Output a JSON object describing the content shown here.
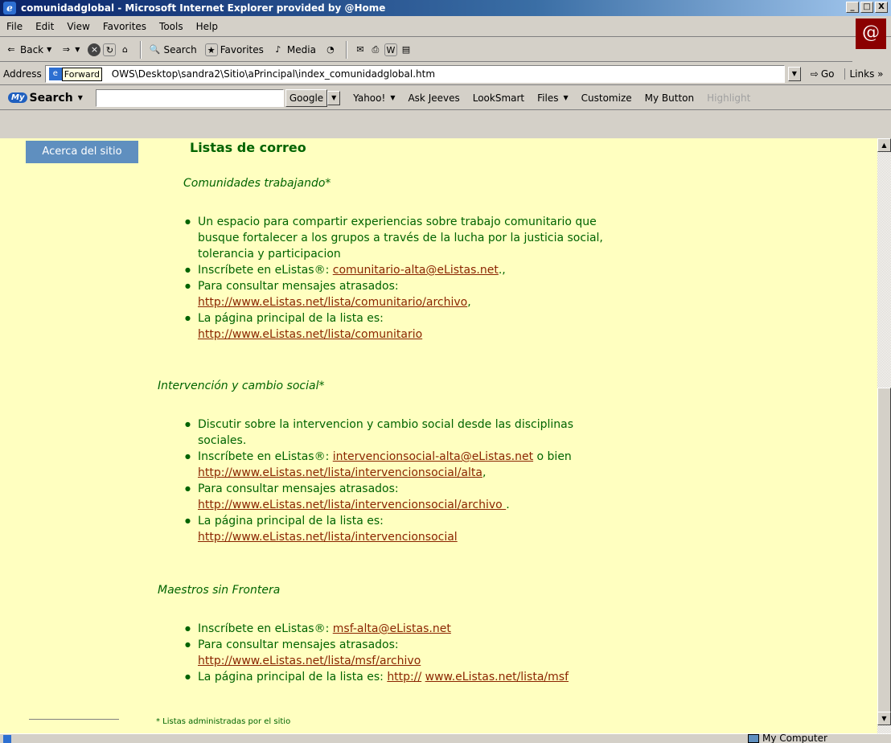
{
  "window": {
    "title": "comunidadglobal - Microsoft Internet Explorer provided by @Home",
    "controls": [
      "_",
      "□",
      "X"
    ]
  },
  "menu": [
    "File",
    "Edit",
    "View",
    "Favorites",
    "Tools",
    "Help"
  ],
  "toolbar": {
    "back": "Back",
    "search": "Search",
    "favorites": "Favorites",
    "media": "Media"
  },
  "address": {
    "label": "Address",
    "url": "OWS\\Desktop\\sandra2\\Sitio\\aPrincipal\\index_comunidadglobal.htm",
    "tooltip": "Forward",
    "go": "Go",
    "links": "Links »"
  },
  "searchbar": {
    "brand_badge": "My",
    "brand": "Search",
    "google": "Google",
    "items": [
      "Yahoo!",
      "Ask Jeeves",
      "LookSmart",
      "Files",
      "Customize",
      "My Button",
      "Highlight"
    ]
  },
  "sidebar": {
    "button": "Acerca del sitio"
  },
  "content": {
    "heading": "Listas de correo",
    "sections": [
      {
        "title": "Comunidades trabajando*",
        "items": [
          {
            "text": "Un espacio para compartir experiencias sobre trabajo comunitario que busque fortalecer a los grupos a través de la lucha por la justicia social, tolerancia y participacion"
          },
          {
            "text": "Inscríbete en eListas®: ",
            "link": "comunitario-alta@eListas.net",
            "after": "., "
          },
          {
            "text": "Para consultar mensajes atrasados: ",
            "link": "http://www.eListas.net/lista/comunitario/archivo",
            "after": ","
          },
          {
            "text": "La página principal de la lista es:",
            "link": "http://www.eListas.net/lista/comunitario",
            "after": ""
          }
        ]
      },
      {
        "title": "Intervención y cambio social*",
        "items": [
          {
            "text": "Discutir sobre la intervencion y cambio social desde las disciplinas sociales."
          },
          {
            "text": "Inscríbete en eListas®: ",
            "link": "intervencionsocial-alta@eListas.net",
            "after": " o bien ",
            "link2": "http://www.eListas.net/lista/intervencionsocial/alta",
            "after2": ","
          },
          {
            "text": "Para consultar mensajes atrasados: ",
            "link": "http://www.eListas.net/lista/intervencionsocial/archivo ",
            "after": "."
          },
          {
            "text": "La página principal de la lista es: ",
            "link": "http://www.eListas.net/lista/intervencionsocial",
            "after": ""
          }
        ]
      },
      {
        "title": "Maestros sin Frontera",
        "items": [
          {
            "text": "Inscríbete en eListas®: ",
            "link": "msf-alta@eListas.net",
            "after": ""
          },
          {
            "text": "Para consultar mensajes atrasados: ",
            "link": "http://www.eListas.net/lista/msf/archivo",
            "after": ""
          },
          {
            "text": "La página principal de la lista es: ",
            "link": "http://",
            "after": " ",
            "link2": "www.eListas.net/lista/msf",
            "after2": ""
          }
        ]
      }
    ],
    "footnote": "* Listas administradas por el sitio"
  },
  "status": {
    "zone": "My Computer"
  },
  "colors": {
    "page_bg": "#ffffc0",
    "text_green": "#006400",
    "link": "#8b2500",
    "sidebar_btn": "#5f8fbf"
  }
}
